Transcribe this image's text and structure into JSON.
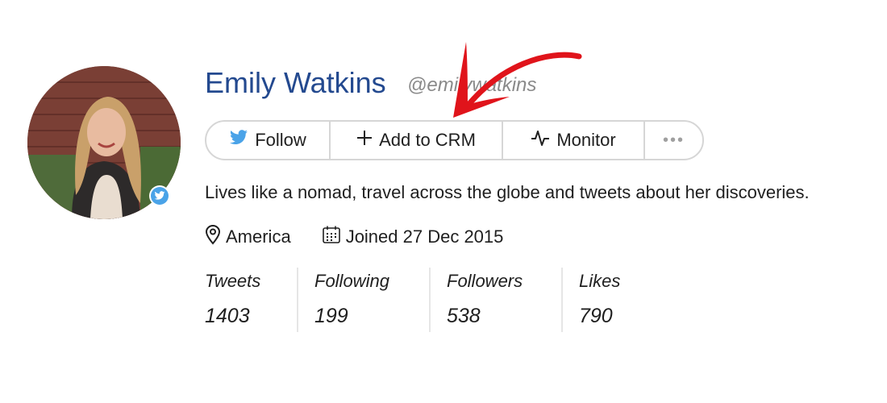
{
  "profile": {
    "name": "Emily Watkins",
    "handle": "@emilywatkins",
    "bio": "Lives like a nomad, travel across the globe and tweets about her discoveries.",
    "location": "America",
    "joined": "Joined 27 Dec 2015"
  },
  "actions": {
    "follow": "Follow",
    "add_to_crm": "Add to CRM",
    "monitor": "Monitor",
    "more": "•••"
  },
  "stats": [
    {
      "label": "Tweets",
      "value": "1403"
    },
    {
      "label": "Following",
      "value": "199"
    },
    {
      "label": "Followers",
      "value": "538"
    },
    {
      "label": "Likes",
      "value": "790"
    }
  ],
  "icons": {
    "follow": "twitter-bird-icon",
    "add": "plus-icon",
    "monitor": "pulse-icon",
    "location": "map-pin-icon",
    "calendar": "calendar-icon",
    "verified": "twitter-verified-icon"
  },
  "colors": {
    "name": "#23498f",
    "twitter_blue": "#4aa3e8",
    "annotation_arrow": "#e0141b"
  }
}
